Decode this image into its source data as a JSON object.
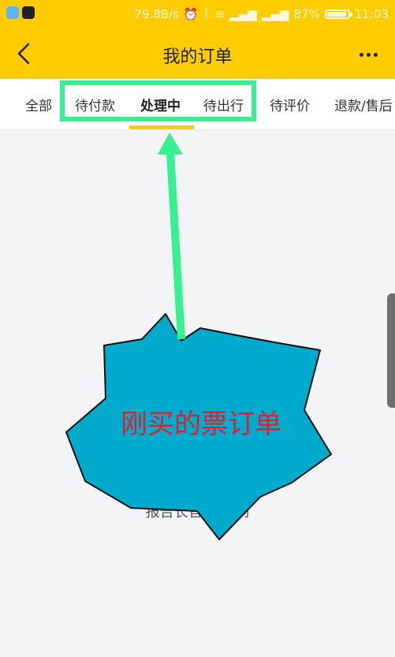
{
  "status_bar": {
    "speed": "79.8B/s",
    "battery_percent": "87%",
    "battery_level": 0.87,
    "time": "11:03"
  },
  "header": {
    "title": "我的订单"
  },
  "tabs": [
    {
      "label": "全部"
    },
    {
      "label": "待付款"
    },
    {
      "label": "处理中"
    },
    {
      "label": "待出行"
    },
    {
      "label": "待评价"
    },
    {
      "label": "退款/售后"
    }
  ],
  "active_tab": "处理中",
  "empty_state": {
    "message": "报告长官，这 到"
  },
  "annotation": {
    "callout_text": "刚买的票订单"
  },
  "colors": {
    "header_bg": "#ffcc00",
    "highlight": "#38f08f",
    "burst_fill": "#00aacc",
    "callout_text": "#e0202a"
  }
}
